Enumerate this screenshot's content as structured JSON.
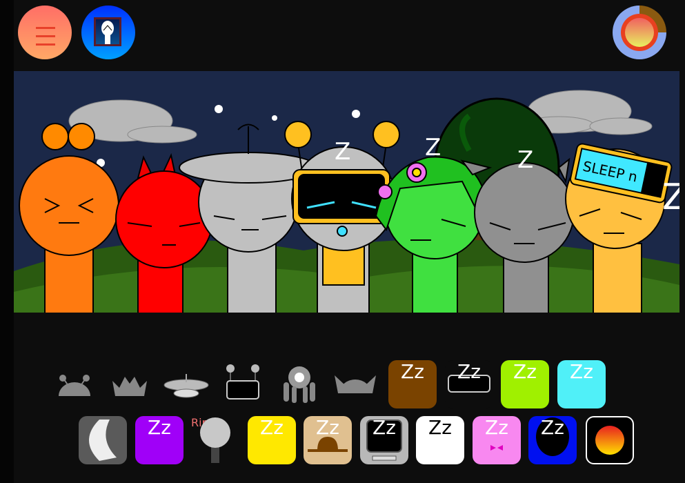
{
  "header": {
    "menu_icon": "hamburger-menu-icon",
    "logo_icon": "character-portrait-icon",
    "settings_icon": "color-wheel-icon"
  },
  "stage": {
    "sleep_marks": [
      "Z",
      "Z",
      "Z",
      "Z"
    ],
    "glasses_text": "SLEEP n",
    "characters": [
      "orange",
      "red",
      "gray-dish",
      "robot",
      "green-flower",
      "gray-cat",
      "yellow-glasses"
    ]
  },
  "palette": {
    "row1": [
      {
        "id": "antenna-hat",
        "label": "",
        "used": true
      },
      {
        "id": "spiky-hat",
        "label": "",
        "used": true
      },
      {
        "id": "dish-hat",
        "label": "",
        "used": true
      },
      {
        "id": "robot-screen",
        "label": "",
        "used": true
      },
      {
        "id": "flower",
        "label": "",
        "used": true
      },
      {
        "id": "cat-ears",
        "label": "",
        "used": true
      },
      {
        "id": "brown-sleep",
        "label": "Zz",
        "color": "#7a4300"
      },
      {
        "id": "black-visor-sleep",
        "label": "Zz",
        "color": "#0d0d0d"
      },
      {
        "id": "lime-sleep",
        "label": "Zz",
        "color": "#a0f000"
      },
      {
        "id": "cyan-bear-sleep",
        "label": "Zz",
        "color": "#50f0f8"
      }
    ],
    "row2": [
      {
        "id": "moon",
        "label": "",
        "color": "#5a5a5a"
      },
      {
        "id": "purple-sleep",
        "label": "Zz",
        "color": "#a000f8"
      },
      {
        "id": "rip-sign",
        "label": "Rip"
      },
      {
        "id": "yellow-sleep",
        "label": "Zz",
        "color": "#ffe800"
      },
      {
        "id": "hat-sleep",
        "label": "Zz",
        "color": "#e0c090"
      },
      {
        "id": "computer-sleep",
        "label": "Zz",
        "color": "#b8b8b8"
      },
      {
        "id": "white-sleep",
        "label": "Zz",
        "color": "#ffffff"
      },
      {
        "id": "pink-bow-sleep",
        "label": "Zz",
        "color": "#f888f0"
      },
      {
        "id": "blue-sleep",
        "label": "Zz",
        "color": "#0010f0"
      },
      {
        "id": "sun-orb",
        "label": "",
        "color": "#000000"
      }
    ]
  }
}
